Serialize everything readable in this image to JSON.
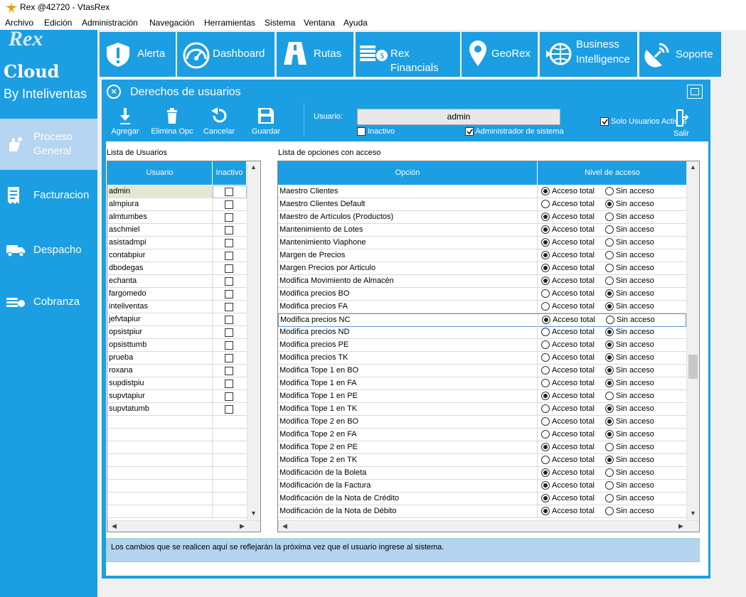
{
  "app": {
    "title": "Rex @42720 - VtasRex"
  },
  "menu": [
    "Archivo",
    "Edición",
    "Administración",
    "Navegación",
    "Herramientas",
    "Sistema",
    "Ventana",
    "Ayuda"
  ],
  "brand": {
    "rex": "Rex",
    "cloud": "Cloud",
    "by": "By Inteliventas"
  },
  "sidebar": {
    "items": [
      {
        "label1": "Proceso",
        "label2": "General",
        "icon": "hand-coin-icon",
        "selected": true
      },
      {
        "label1": "Facturacion",
        "icon": "receipt-icon"
      },
      {
        "label1": "Despacho",
        "icon": "truck-icon"
      },
      {
        "label1": "Cobranza",
        "icon": "money-icon"
      }
    ]
  },
  "topnav": [
    {
      "label": "Alerta",
      "icon": "shield-alert-icon"
    },
    {
      "label": "Dashboard",
      "icon": "gauge-icon"
    },
    {
      "label": "Rutas",
      "icon": "road-icon"
    },
    {
      "label": "Rex Financials",
      "icon": "coins-icon"
    },
    {
      "label": "GeoRex",
      "icon": "map-pin-icon"
    },
    {
      "label1": "Business",
      "label2": "Intelligence",
      "icon": "globe-icon"
    },
    {
      "label": "Soporte",
      "icon": "satellite-icon"
    }
  ],
  "window": {
    "title": "Derechos de usuarios",
    "toolbar": {
      "add": "Agregar",
      "delete": "Elimina Opc",
      "cancel": "Cancelar",
      "save": "Guardar",
      "exit": "Salir"
    },
    "user_label": "Usuario:",
    "user_value": "admin",
    "inactivo_label": "Inactivo",
    "inactivo_checked": false,
    "admin_label": "Administrador de sistema",
    "admin_checked": true,
    "solo_activos_label": "Solo Usuarios Activos",
    "solo_activos_checked": true,
    "users_caption": "Lista de Usuarios",
    "options_caption": "Lista de opciones con acceso",
    "users_headers": {
      "user": "Usuario",
      "inactive": "Inactivo"
    },
    "users": [
      "admin",
      "almpiura",
      "almtumbes",
      "aschmiel",
      "asistadmpi",
      "contabpiur",
      "dbodegas",
      "echanta",
      "fargomedo",
      "inteliventas",
      "jefvtapiur",
      "opsistpiur",
      "opsisttumb",
      "prueba",
      "roxana",
      "supdistpiu",
      "supvtapiur",
      "supvtatumb"
    ],
    "options_headers": {
      "option": "Opción",
      "level": "Nivel de acceso"
    },
    "radio_labels": {
      "total": "Acceso total",
      "none": "Sin acceso"
    },
    "options": [
      {
        "name": "Maestro Clientes",
        "total": true
      },
      {
        "name": "Maestro Clientes Default",
        "total": false
      },
      {
        "name": "Maestro de Artículos (Productos)",
        "total": true
      },
      {
        "name": "Mantenimiento de Lotes",
        "total": true
      },
      {
        "name": "Mantenimiento Viaphone",
        "total": true
      },
      {
        "name": "Margen de Precios",
        "total": true
      },
      {
        "name": "Margen Precios por Articulo",
        "total": true
      },
      {
        "name": "Modifica Movimiento de Almacén",
        "total": true
      },
      {
        "name": "Modifica precios BO",
        "total": false
      },
      {
        "name": "Modifica precios FA",
        "total": false
      },
      {
        "name": "Modifica precios NC",
        "total": true
      },
      {
        "name": "Modifica precios ND",
        "total": false
      },
      {
        "name": "Modifica precios PE",
        "total": false
      },
      {
        "name": "Modifica precios TK",
        "total": false
      },
      {
        "name": "Modifica Tope 1 en BO",
        "total": false
      },
      {
        "name": "Modifica Tope 1 en FA",
        "total": false
      },
      {
        "name": "Modifica Tope 1 en PE",
        "total": true
      },
      {
        "name": "Modifica Tope 1 en TK",
        "total": false
      },
      {
        "name": "Modifica Tope 2 en BO",
        "total": false
      },
      {
        "name": "Modifica Tope 2 en FA",
        "total": false
      },
      {
        "name": "Modifica Tope 2 en PE",
        "total": true
      },
      {
        "name": "Modifica Tope 2 en TK",
        "total": false
      },
      {
        "name": "Modificación de la Boleta",
        "total": true
      },
      {
        "name": "Modificación de la Factura",
        "total": true
      },
      {
        "name": "Modificación de la Nota de Crédito",
        "total": true
      },
      {
        "name": "Modificación de la Nota de Débito",
        "total": true
      }
    ],
    "selected_option_index": 10,
    "hint": "Los cambios que se realicen aquí se reflejarán la próxima vez que el usuario ingrese al sistema."
  },
  "colors": {
    "accent": "#1c9ee3",
    "selected_side": "#b5d5f0",
    "hint_bg": "#b5d2ee"
  }
}
